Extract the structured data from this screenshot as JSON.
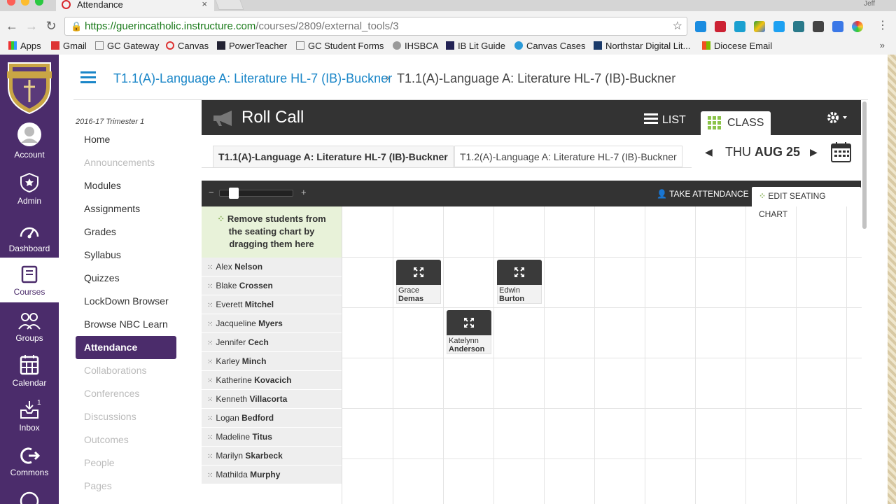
{
  "browser": {
    "tab_title": "Attendance",
    "tab_close": "×",
    "profile": "Jeff",
    "url_scheme": "https://",
    "url_host": "guerincatholic.instructure.com",
    "url_path": "/courses/2809/external_tools/3",
    "bookmarks": [
      "Apps",
      "Gmail",
      "GC Gateway",
      "Canvas",
      "PowerTeacher",
      "GC Student Forms",
      "IHSBCA",
      "IB Lit Guide",
      "Canvas Cases",
      "Northstar Digital Lit...",
      "Diocese Email"
    ],
    "bookmarks_more": "»"
  },
  "global_nav": {
    "items": [
      {
        "label": "Account",
        "icon": "account-icon"
      },
      {
        "label": "Admin",
        "icon": "admin-shield-icon"
      },
      {
        "label": "Dashboard",
        "icon": "dashboard-icon"
      },
      {
        "label": "Courses",
        "icon": "courses-book-icon"
      },
      {
        "label": "Groups",
        "icon": "groups-icon"
      },
      {
        "label": "Calendar",
        "icon": "calendar-icon"
      },
      {
        "label": "Inbox",
        "icon": "inbox-icon"
      },
      {
        "label": "Commons",
        "icon": "commons-icon"
      }
    ],
    "inbox_badge": "1",
    "active": "Courses",
    "accent": "#4b2c6b"
  },
  "breadcrumb": {
    "course": "T1.1(A)-Language A: Literature HL-7 (IB)-Buckner",
    "separator": "›",
    "current": "T1.1(A)-Language A: Literature HL-7 (IB)-Buckner"
  },
  "course_nav": {
    "term": "2016-17 Trimester 1",
    "items": [
      {
        "label": "Home",
        "state": "enabled"
      },
      {
        "label": "Announcements",
        "state": "disabled"
      },
      {
        "label": "Modules",
        "state": "enabled"
      },
      {
        "label": "Assignments",
        "state": "enabled"
      },
      {
        "label": "Grades",
        "state": "enabled"
      },
      {
        "label": "Syllabus",
        "state": "enabled"
      },
      {
        "label": "Quizzes",
        "state": "enabled"
      },
      {
        "label": "LockDown Browser",
        "state": "enabled"
      },
      {
        "label": "Browse NBC Learn",
        "state": "enabled"
      },
      {
        "label": "Attendance",
        "state": "active"
      },
      {
        "label": "Collaborations",
        "state": "disabled"
      },
      {
        "label": "Conferences",
        "state": "disabled"
      },
      {
        "label": "Discussions",
        "state": "disabled"
      },
      {
        "label": "Outcomes",
        "state": "disabled"
      },
      {
        "label": "People",
        "state": "disabled"
      },
      {
        "label": "Pages",
        "state": "disabled"
      }
    ]
  },
  "roll_call": {
    "title": "Roll Call",
    "view_list": "LIST",
    "view_class": "CLASS",
    "section_tabs": [
      "T1.1(A)-Language A: Literature HL-7 (IB)-Buckner",
      "T1.2(A)-Language A: Literature HL-7 (IB)-Buckner"
    ],
    "date_day": "THU",
    "date_month_day": "AUG 25",
    "take_attendance": "TAKE ATTENDANCE",
    "edit_seating_chart": "EDIT SEATING CHART",
    "zoom_minus": "−",
    "zoom_plus": "+",
    "zoom_level": 0.15,
    "dropzone": "Remove students from the seating chart by dragging them here",
    "unassigned": [
      {
        "first": "Alex",
        "last": "Nelson"
      },
      {
        "first": "Blake",
        "last": "Crossen"
      },
      {
        "first": "Everett",
        "last": "Mitchel"
      },
      {
        "first": "Jacqueline",
        "last": "Myers"
      },
      {
        "first": "Jennifer",
        "last": "Cech"
      },
      {
        "first": "Karley",
        "last": "Minch"
      },
      {
        "first": "Katherine",
        "last": "Kovacich"
      },
      {
        "first": "Kenneth",
        "last": "Villacorta"
      },
      {
        "first": "Logan",
        "last": "Bedford"
      },
      {
        "first": "Madeline",
        "last": "Titus"
      },
      {
        "first": "Marilyn",
        "last": "Skarbeck"
      },
      {
        "first": "Mathilda",
        "last": "Murphy"
      }
    ],
    "seated": [
      {
        "first": "Grace",
        "last": "Demas"
      },
      {
        "first": "Edwin",
        "last": "Burton"
      },
      {
        "first": "Katelynn",
        "last": "Anderson"
      }
    ]
  }
}
